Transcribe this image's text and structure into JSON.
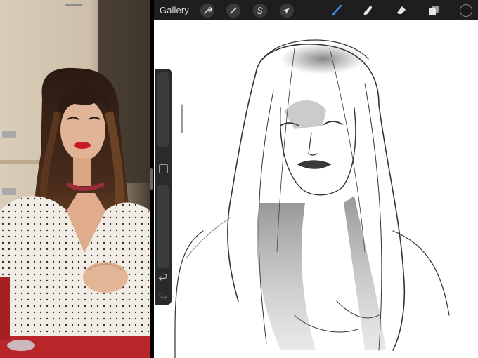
{
  "toolbar": {
    "gallery_label": "Gallery",
    "actions_icon": "wrench-icon",
    "adjustments_icon": "magic-wand-icon",
    "selection_icon": "selection-s-icon",
    "transform_icon": "arrow-cursor-icon",
    "brush_icon": "brush-icon",
    "smudge_icon": "smudge-finger-icon",
    "eraser_icon": "eraser-icon",
    "layers_icon": "layers-icon",
    "color_icon": "color-swatch-icon",
    "active_tool": "brush",
    "accent_color": "#3a8ef6",
    "current_color": "#1a1a1a"
  },
  "sidebar": {
    "brush_size_slider": "brush-size",
    "modify_button": "modify-square",
    "opacity_slider": "brush-opacity",
    "undo_icon": "undo-arrow-icon",
    "redo_icon": "redo-arrow-icon"
  },
  "panes": {
    "left": "reference-photo",
    "right": "drawing-canvas"
  }
}
